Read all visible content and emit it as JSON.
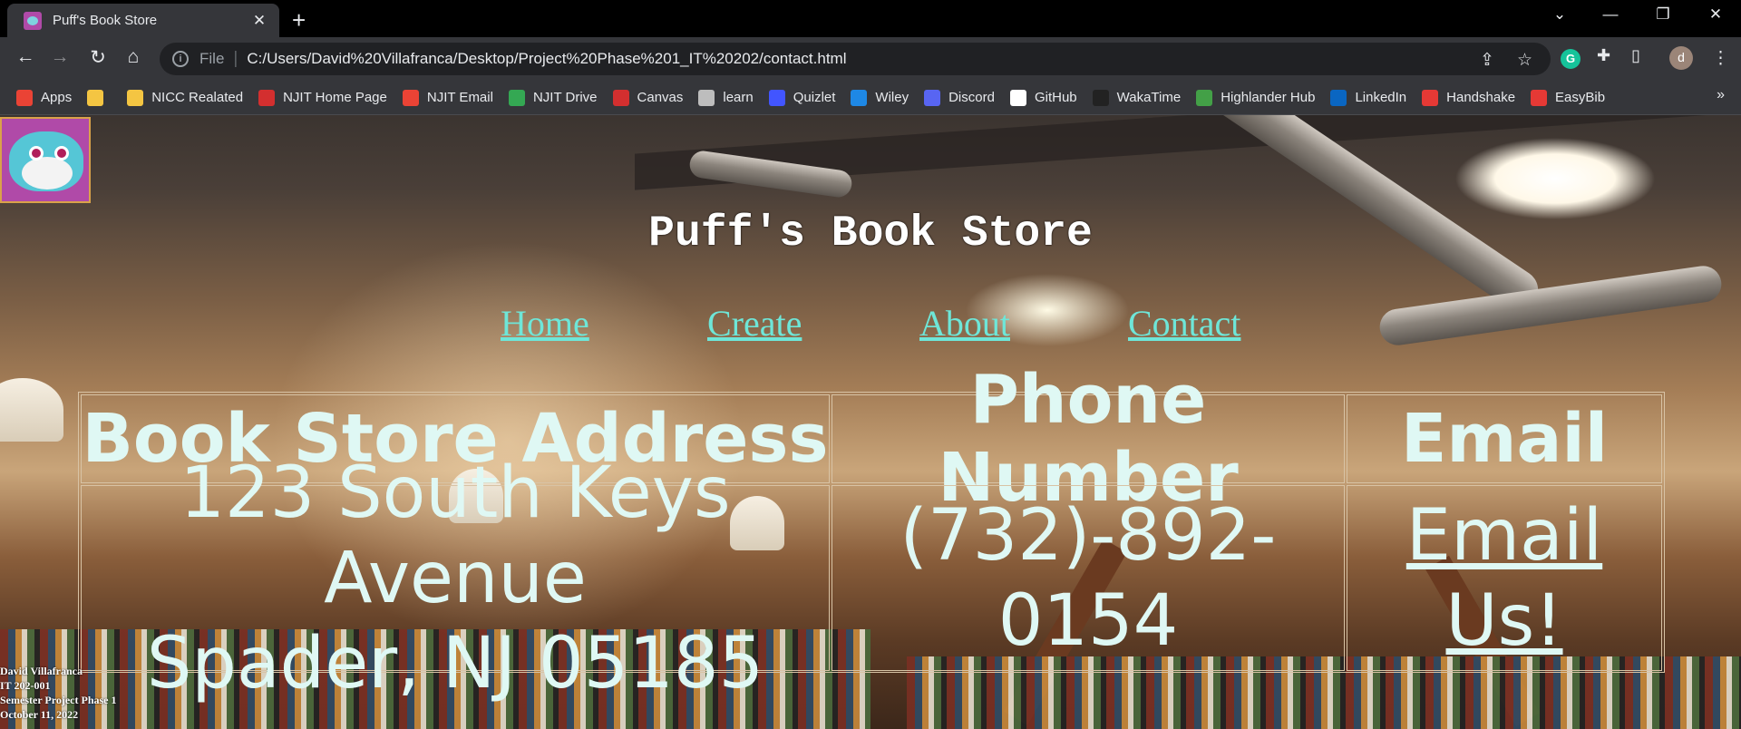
{
  "browser": {
    "tab_title": "Puff's Book Store",
    "url_scheme": "File",
    "url": "C:/Users/David%20Villafranca/Desktop/Project%20Phase%201_IT%20202/contact.html",
    "profile_initial": "d",
    "bookmarks": [
      {
        "label": "Apps",
        "color": "#ea4335"
      },
      {
        "label": "",
        "color": "#f4c542"
      },
      {
        "label": "NICC Realated",
        "color": "#f4c542"
      },
      {
        "label": "NJIT Home Page",
        "color": "#d32f2f"
      },
      {
        "label": "NJIT Email",
        "color": "#ea4335"
      },
      {
        "label": "NJIT Drive",
        "color": "#34a853"
      },
      {
        "label": "Canvas",
        "color": "#d32f2f"
      },
      {
        "label": "learn",
        "color": "#bdbdbd"
      },
      {
        "label": "Quizlet",
        "color": "#4255ff"
      },
      {
        "label": "Wiley",
        "color": "#1e88e5"
      },
      {
        "label": "Discord",
        "color": "#5865f2"
      },
      {
        "label": "GitHub",
        "color": "#ffffff"
      },
      {
        "label": "WakaTime",
        "color": "#222222"
      },
      {
        "label": "Highlander Hub",
        "color": "#43a047"
      },
      {
        "label": "LinkedIn",
        "color": "#0a66c2"
      },
      {
        "label": "Handshake",
        "color": "#e53935"
      },
      {
        "label": "EasyBib",
        "color": "#e53935"
      }
    ]
  },
  "site": {
    "title": "Puff's Book Store",
    "nav": {
      "home": "Home",
      "create": "Create",
      "about": "About",
      "contact": "Contact"
    },
    "table": {
      "headers": {
        "address": "Book Store Address",
        "phone": "Phone Number",
        "email": "Email"
      },
      "address_line1": "123 South Keys Avenue",
      "address_line2": "Spader, NJ 05185",
      "phone": "(732)-892-0154",
      "email_link": "Email Us!"
    },
    "footer": {
      "name": "David Villafranca",
      "course": "IT 202-001",
      "project": "Semester Project Phase 1",
      "date": "October 11, 2022"
    }
  }
}
